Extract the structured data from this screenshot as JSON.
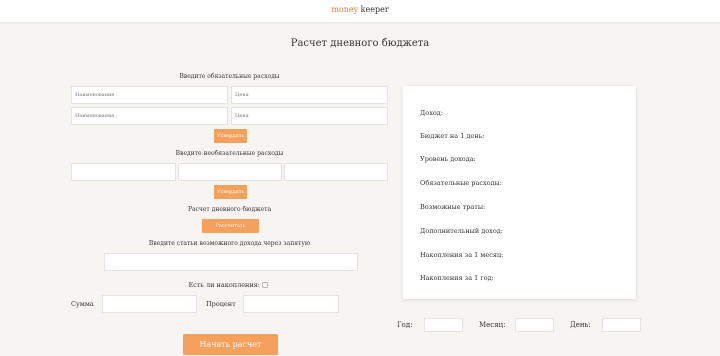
{
  "brand": {
    "accent": "money",
    "rest": "keeper"
  },
  "page_title": "Расчет дневного бюджета",
  "mandatory": {
    "heading": "Введите обязательные расходы",
    "name_placeholder": "Наименование",
    "price_placeholder": "Цена",
    "approve_label": "Утвердить"
  },
  "optional": {
    "heading": "Введите необязательные расходы",
    "approve_label": "Утвердить"
  },
  "daily_budget": {
    "heading": "Расчет дневного бюджета",
    "calc_label": "Рассчитать"
  },
  "income_items": {
    "heading": "Введите статьи возможного дохода через запятую"
  },
  "savings": {
    "question": "Есть ли накопления:",
    "amount_label": "Сумма",
    "percent_label": "Процент"
  },
  "start_button_label": "Начать расчет",
  "summary": {
    "income": "Доход:",
    "budget_per_day": "Бюджет на 1 день:",
    "income_level": "Уровень дохода:",
    "mandatory_expenses": "Обязательные расходы:",
    "possible_spending": "Возможные траты:",
    "extra_income": "Дополнительный доход:",
    "savings_month": "Накопления за 1 месяц:",
    "savings_year": "Накопления за 1 год:"
  },
  "date": {
    "year_label": "Год:",
    "month_label": "Месяц:",
    "day_label": "День:"
  },
  "colors": {
    "accent": "#f5a05c",
    "brand_accent": "#e07b39",
    "background": "#f6f5f2"
  }
}
